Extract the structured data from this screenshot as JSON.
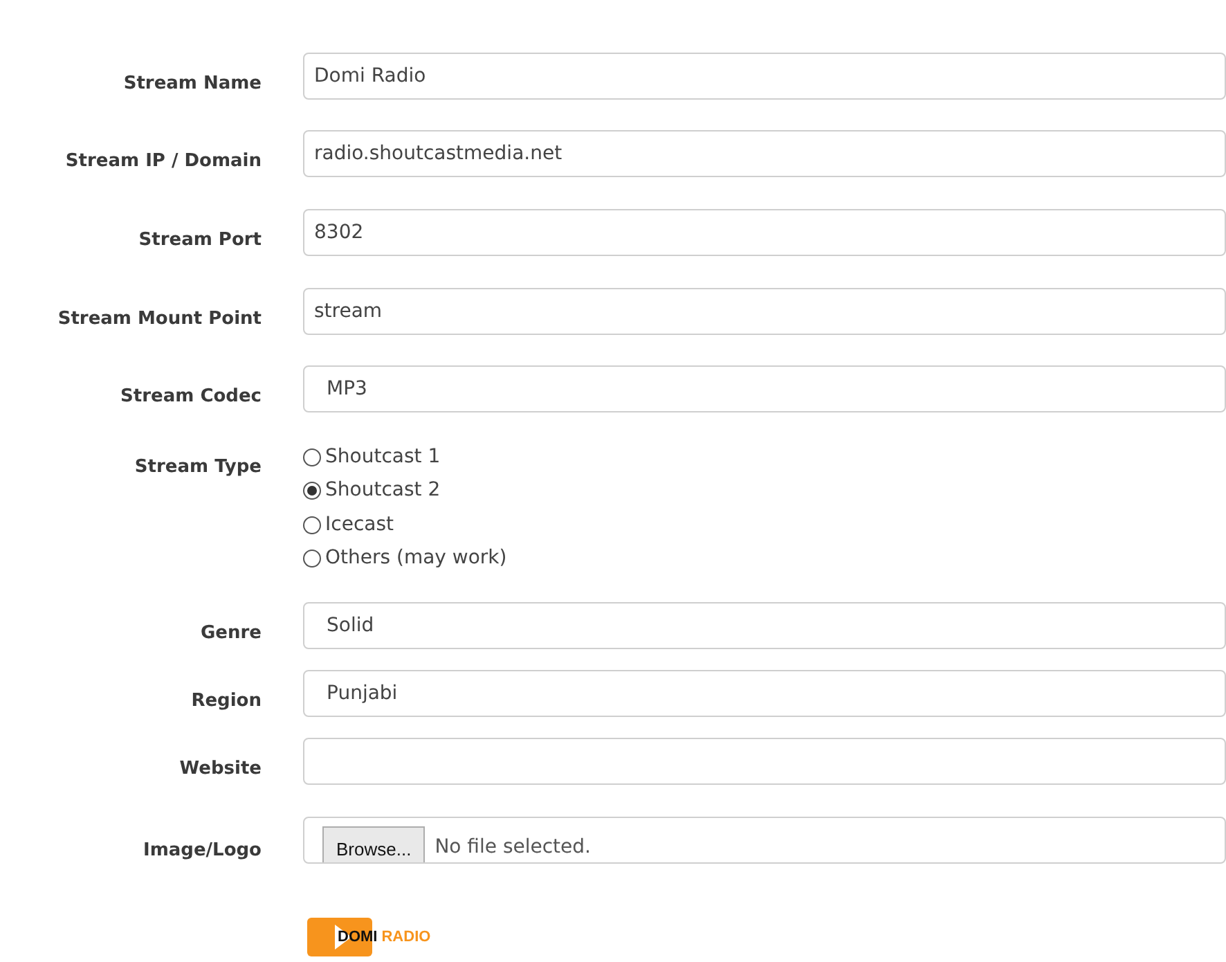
{
  "fields": [
    {
      "kind": "text",
      "label": "Stream Name",
      "value": "Domi Radio"
    },
    {
      "kind": "text",
      "label": "Stream IP / Domain",
      "value": "radio.shoutcastmedia.net"
    },
    {
      "kind": "text",
      "label": "Stream Port",
      "value": "8302"
    },
    {
      "kind": "text",
      "label": "Stream Mount Point",
      "value": "stream"
    },
    {
      "kind": "select",
      "label": "Stream Codec",
      "value": "MP3"
    },
    {
      "kind": "radio",
      "label": "Stream Type",
      "options": [
        {
          "label": "Shoutcast 1",
          "selected": false
        },
        {
          "label": "Shoutcast 2",
          "selected": true
        },
        {
          "label": "Icecast",
          "selected": false
        },
        {
          "label": "Others (may work)",
          "selected": false
        }
      ]
    },
    {
      "kind": "select",
      "label": "Genre",
      "value": "Solid"
    },
    {
      "kind": "select",
      "label": "Region",
      "value": "Punjabi"
    },
    {
      "kind": "text",
      "label": "Website"
    },
    {
      "kind": "file",
      "label": "Image/Logo",
      "button": "Browse...",
      "status": "No file selected."
    }
  ],
  "logo": {
    "word1": "DOMI",
    "word2": "RADIO"
  }
}
